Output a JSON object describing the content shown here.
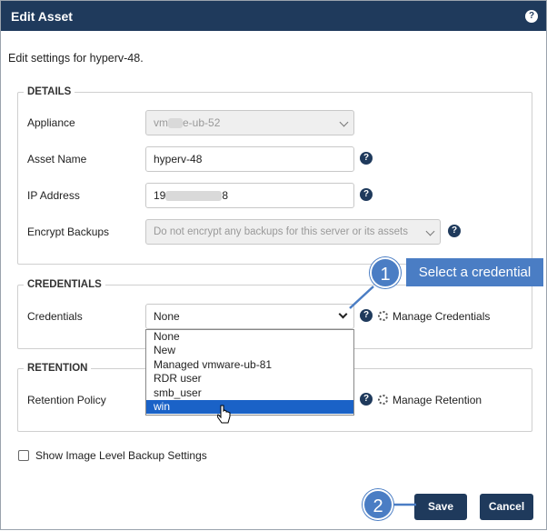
{
  "dialog": {
    "title": "Edit Asset",
    "help_glyph": "?",
    "subtitle": "Edit settings for hyperv-48."
  },
  "details": {
    "legend": "DETAILS",
    "appliance": {
      "label": "Appliance",
      "value_prefix": "vm",
      "value_suffix": "e-ub-52"
    },
    "asset_name": {
      "label": "Asset Name",
      "value": "hyperv-48"
    },
    "ip_address": {
      "label": "IP Address",
      "value_prefix": "19",
      "value_suffix": "8"
    },
    "encrypt_backups": {
      "label": "Encrypt Backups",
      "value": "Do not encrypt any backups for this server or its assets"
    }
  },
  "credentials": {
    "legend": "CREDENTIALS",
    "label": "Credentials",
    "value": "None",
    "manage_label": "Manage Credentials",
    "options": [
      "None",
      "New",
      "Managed vmware-ub-81",
      "RDR user",
      "smb_user",
      "win"
    ],
    "selected_index": 5
  },
  "retention": {
    "legend": "RETENTION",
    "label": "Retention Policy",
    "manage_label": "Manage Retention"
  },
  "show_image_level": {
    "label": "Show Image Level Backup Settings",
    "checked": false
  },
  "buttons": {
    "save": "Save",
    "cancel": "Cancel"
  },
  "callouts": {
    "step1_number": "1",
    "step1_text": "Select a credential",
    "step2_number": "2"
  },
  "icons": {
    "help": "question-circle-icon",
    "gear": "gear-icon",
    "chevron": "chevron-down-icon",
    "cursor": "pointer-cursor-icon"
  },
  "colors": {
    "titlebar": "#1f3a5c",
    "button": "#1f3a5c",
    "callout": "#4a7dc4",
    "selected_option": "#1a62c7"
  }
}
